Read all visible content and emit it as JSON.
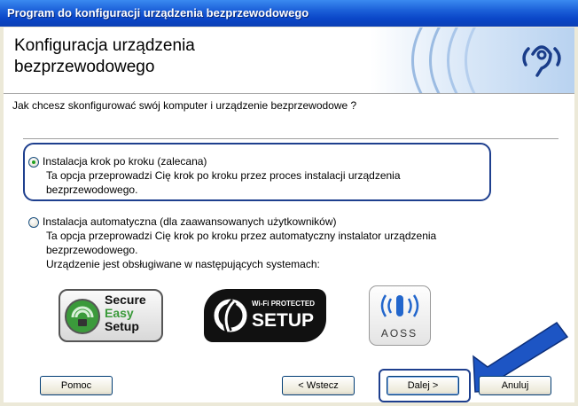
{
  "window": {
    "title": "Program do konfiguracji urządzenia bezprzewodowego"
  },
  "header": {
    "title_line1": "Konfiguracja urządzenia",
    "title_line2": "bezprzewodowego"
  },
  "question": "Jak chcesz skonfigurować swój komputer i urządzenie bezprzewodowe ?",
  "options": [
    {
      "label": "Instalacja krok po kroku (zalecana)",
      "desc1": "Ta opcja przeprowadzi Cię krok po kroku przez proces instalacji urządzenia",
      "desc2": "bezprzewodowego.",
      "selected": true
    },
    {
      "label": "Instalacja automatyczna (dla zaawansowanych użytkowników)",
      "desc1": "Ta opcja przeprowadzi Cię krok po kroku przez automatyczny instalator urządzenia",
      "desc2": "bezprzewodowego.",
      "desc3": "Urządzenie jest obsługiwane w następujących systemach:",
      "selected": false
    }
  ],
  "logos": {
    "secure_easy_setup": {
      "line1": "Secure",
      "line2": "Easy",
      "line3": "Setup"
    },
    "wps": {
      "line1": "Wi-Fi PROTECTED",
      "line2": "SETUP"
    },
    "aoss": {
      "text": "AOSS"
    }
  },
  "buttons": {
    "help": "Pomoc",
    "back": "< Wstecz",
    "next": "Dalej >",
    "cancel": "Anuluj"
  },
  "colors": {
    "titlebar": "#0a46c8",
    "highlight_border": "#1e3f8e",
    "arrow": "#1d55c4"
  }
}
